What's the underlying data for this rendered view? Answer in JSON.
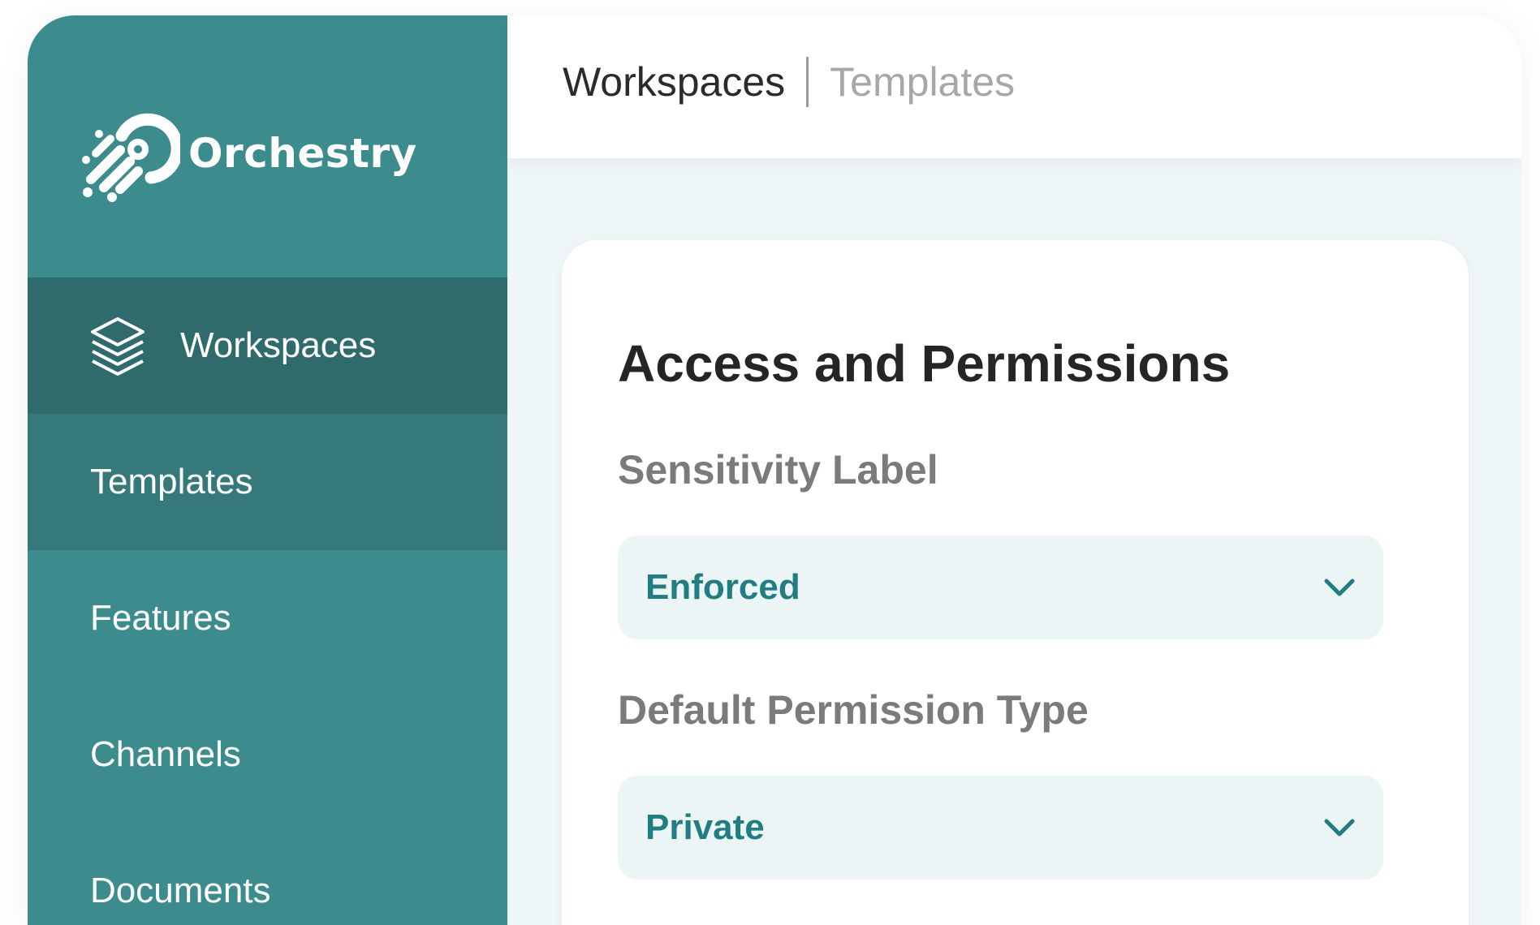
{
  "app": {
    "name": "Orchestry"
  },
  "sidebar": {
    "items": [
      {
        "label": "Workspaces",
        "icon": "layers-icon",
        "state": "active"
      },
      {
        "label": "Templates",
        "icon": "",
        "state": "sub-selected"
      },
      {
        "label": "Features",
        "icon": "",
        "state": "default"
      },
      {
        "label": "Channels",
        "icon": "",
        "state": "default"
      },
      {
        "label": "Documents",
        "icon": "",
        "state": "default"
      }
    ]
  },
  "header": {
    "breadcrumb_current": "Workspaces",
    "breadcrumb_other": "Templates"
  },
  "card": {
    "title": "Access and Permissions",
    "fields": [
      {
        "label": "Sensitivity Label",
        "value": "Enforced"
      },
      {
        "label": "Default Permission Type",
        "value": "Private"
      }
    ]
  },
  "colors": {
    "sidebar": "#3c8c8e",
    "sidebar_active": "#2f6b6d",
    "accent_text": "#227d82",
    "select_bg": "#ecf5f6"
  }
}
